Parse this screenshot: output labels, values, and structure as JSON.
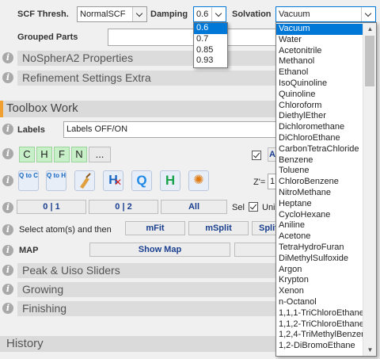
{
  "header": {
    "scf_label": "SCF Thresh.",
    "scf_value": "NormalSCF",
    "damping_label": "Damping",
    "damping_value": "0.6",
    "solvation_label": "Solvation",
    "solvation_value": "Vacuum",
    "grouped_parts_label": "Grouped Parts"
  },
  "damping_options": [
    "0.6",
    "0.7",
    "0.85",
    "0.93"
  ],
  "damping_selected_index": 0,
  "solvation_options": [
    "Vacuum",
    "Water",
    "Acetonitrile",
    "Methanol",
    "Ethanol",
    "IsoQuinoline",
    "Quinoline",
    "Chloroform",
    "DiethylEther",
    "Dichloromethane",
    "DiChloroEthane",
    "CarbonTetraChloride",
    "Benzene",
    "Toluene",
    "ChloroBenzene",
    "NitroMethane",
    "Heptane",
    "CycloHexane",
    "Aniline",
    "Acetone",
    "TetraHydroFuran",
    "DiMethylSulfoxide",
    "Argon",
    "Krypton",
    "Xenon",
    "n-Octanol",
    "1,1,1-TriChloroEthane",
    "1,1,2-TriChloroEthane",
    "1,2,4-TriMethylBenzer",
    "1,2-DiBromoEthane"
  ],
  "solvation_selected_index": 0,
  "sections": {
    "nosphera2": "NoSpherA2 Properties",
    "refinement_extra": "Refinement Settings Extra",
    "toolbox_work": "Toolbox Work",
    "peak_uiso": "Peak & Uiso Sliders",
    "growing": "Growing",
    "finishing": "Finishing",
    "history": "History"
  },
  "toolbox": {
    "labels_label": "Labels",
    "labels_value": "Labels OFF/ON",
    "elements": [
      "C",
      "H",
      "F",
      "N",
      "..."
    ],
    "a_button": "A",
    "tools": [
      {
        "icon": "q-to-c-icon",
        "text": "Q to C"
      },
      {
        "icon": "q-to-h-icon",
        "text": "Q to H"
      },
      {
        "icon": "clean-broom-icon",
        "text": ""
      },
      {
        "icon": "remove-h-icon",
        "text": "H"
      },
      {
        "icon": "q-refresh-icon",
        "text": "Q"
      },
      {
        "icon": "h-add-icon",
        "text": "H"
      },
      {
        "icon": "center-atoms-icon",
        "text": ""
      }
    ],
    "z_label": "Z'=",
    "z_value": "1",
    "part_buttons": [
      "0 | 1",
      "0 | 2",
      "All"
    ],
    "sel_label": "Sel",
    "uniq_label": "Uniq",
    "select_text": "Select atom(s) and then",
    "mfit": "mFit",
    "msplit": "mSplit",
    "split": "Split",
    "map_label": "MAP",
    "show_map": "Show Map"
  },
  "colors": {
    "accent_orange": "#f0a030",
    "selection_blue": "#0078d7",
    "element_green": "#c8f0c8",
    "button_text": "#1a3f8f"
  }
}
